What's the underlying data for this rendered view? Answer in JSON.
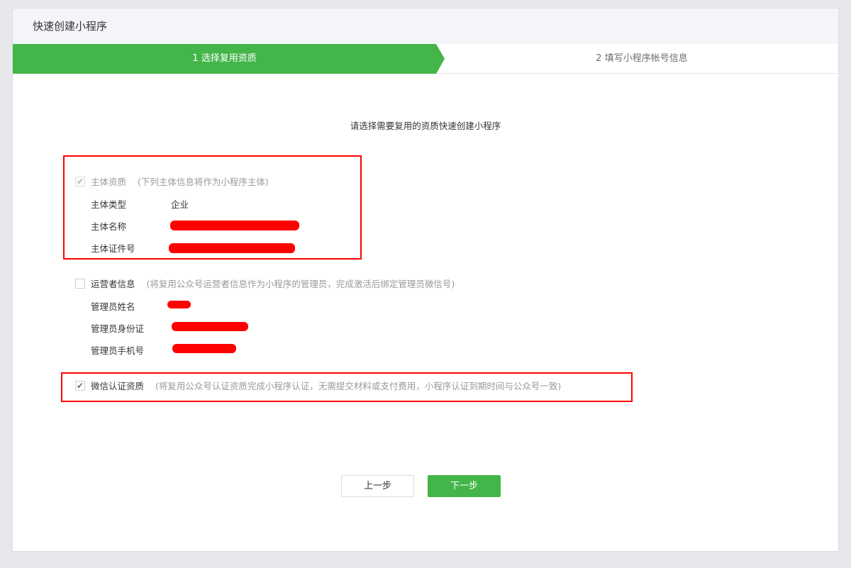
{
  "header": {
    "title": "快速创建小程序"
  },
  "steps": [
    {
      "label": "1 选择复用资质",
      "active": true
    },
    {
      "label": "2 填写小程序帐号信息",
      "active": false
    }
  ],
  "subtitle": "请选择需要复用的资质快速创建小程序",
  "sections": {
    "subject": {
      "label": "主体资质",
      "hint": "(下列主体信息将作为小程序主体)",
      "checked": true,
      "disabled": true,
      "fields": [
        {
          "label": "主体类型",
          "value": "企业"
        },
        {
          "label": "主体名称",
          "value": ""
        },
        {
          "label": "主体证件号",
          "value": ""
        }
      ]
    },
    "operator": {
      "label": "运营者信息",
      "hint": "(将复用公众号运营者信息作为小程序的管理员，完成激活后绑定管理员微信号)",
      "checked": false,
      "fields": [
        {
          "label": "管理员姓名",
          "value": ""
        },
        {
          "label": "管理员身份证",
          "value": ""
        },
        {
          "label": "管理员手机号",
          "value": ""
        }
      ]
    },
    "certification": {
      "label": "微信认证资质",
      "hint": "(将复用公众号认证资质完成小程序认证，无需提交材料或支付费用，小程序认证到期时间与公众号一致)",
      "checked": true
    }
  },
  "buttons": {
    "prev": "上一步",
    "next": "下一步"
  },
  "colors": {
    "accent": "#44b549",
    "highlight": "#ff0000",
    "redaction": "#ff0000"
  }
}
